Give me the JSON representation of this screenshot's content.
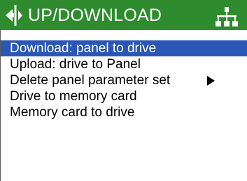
{
  "header": {
    "title": "UP/DOWNLOAD",
    "left_icon": "transfer-arrows-icon",
    "right_icon": "network-tree-icon",
    "background_color": "#2e8b2e",
    "text_color": "#ffffff"
  },
  "menu": {
    "selected_index": 0,
    "selection_color": "#2a57b5",
    "items": [
      {
        "label": "Download: panel to drive",
        "has_submenu": false
      },
      {
        "label": "Upload: drive to Panel",
        "has_submenu": false
      },
      {
        "label": "Delete panel parameter set",
        "has_submenu": true,
        "submenu_icon": "triangle-right-icon"
      },
      {
        "label": "Drive to memory card",
        "has_submenu": false
      },
      {
        "label": "Memory card to drive",
        "has_submenu": false
      }
    ]
  }
}
